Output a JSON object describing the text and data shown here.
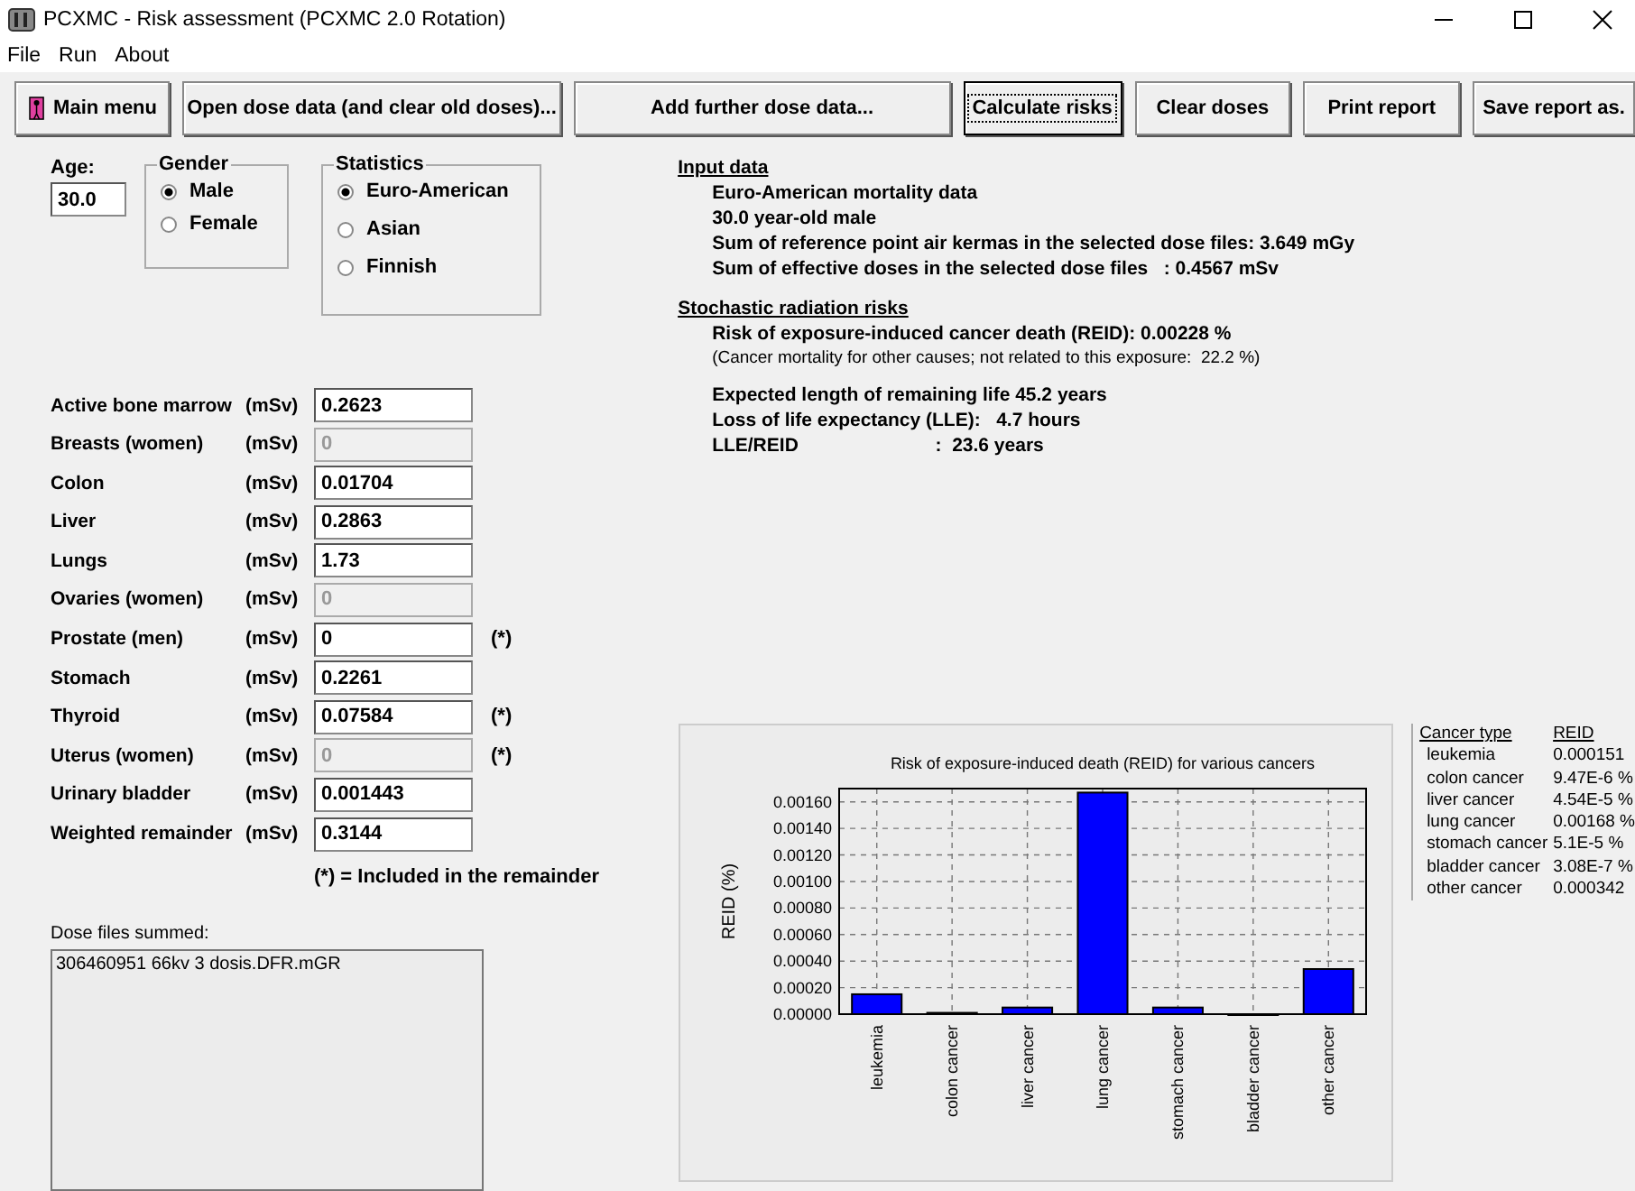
{
  "window": {
    "title": "PCXMC - Risk assessment (PCXMC 2.0 Rotation)"
  },
  "menu": [
    "File",
    "Run",
    "About"
  ],
  "toolbar": [
    {
      "label": "Main menu",
      "kind": "icon",
      "focused": false
    },
    {
      "label": "Open dose data (and clear old doses)...",
      "kind": "text",
      "focused": false
    },
    {
      "label": "Add further dose data...",
      "kind": "text",
      "focused": false
    },
    {
      "label": "Calculate risks",
      "kind": "text",
      "focused": true
    },
    {
      "label": "Clear doses",
      "kind": "text",
      "focused": false
    },
    {
      "label": "Print report",
      "kind": "text",
      "focused": false
    },
    {
      "label": "Save report as.",
      "kind": "text",
      "focused": false
    }
  ],
  "age": {
    "label": "Age:",
    "value": "30.0"
  },
  "gender": {
    "title": "Gender",
    "options": [
      {
        "label": "Male",
        "selected": true
      },
      {
        "label": "Female",
        "selected": false
      }
    ]
  },
  "statistics": {
    "title": "Statistics",
    "options": [
      {
        "label": "Euro-American",
        "selected": true
      },
      {
        "label": "Asian",
        "selected": false
      },
      {
        "label": "Finnish",
        "selected": false
      }
    ]
  },
  "organs": [
    {
      "label": "Active bone marrow",
      "unit": "(mSv)",
      "value": "0.2623",
      "disabled": false
    },
    {
      "label": "Breasts  (women)",
      "unit": "(mSv)",
      "value": "0",
      "disabled": true
    },
    {
      "label": "Colon",
      "unit": "(mSv)",
      "value": "0.01704",
      "disabled": false
    },
    {
      "label": "Liver",
      "unit": "(mSv)",
      "value": "0.2863",
      "disabled": false
    },
    {
      "label": "Lungs",
      "unit": "(mSv)",
      "value": "1.73",
      "disabled": false
    },
    {
      "label": "Ovaries (women)",
      "unit": "(mSv)",
      "value": "0",
      "disabled": true
    },
    {
      "label": "Prostate (men)",
      "unit": "(mSv)",
      "value": "0",
      "disabled": false,
      "note": "(*)"
    },
    {
      "label": "Stomach",
      "unit": "(mSv)",
      "value": "0.2261",
      "disabled": false
    },
    {
      "label": "Thyroid",
      "unit": "(mSv)",
      "value": "0.07584",
      "disabled": false,
      "note": "(*)"
    },
    {
      "label": "Uterus (women)",
      "unit": "(mSv)",
      "value": "0",
      "disabled": true,
      "note": "(*)"
    },
    {
      "label": "Urinary bladder",
      "unit": "(mSv)",
      "value": "0.001443",
      "disabled": false
    },
    {
      "label": "Weighted remainder",
      "unit": "(mSv)",
      "value": "0.3144",
      "disabled": false
    }
  ],
  "remainder_note": "(*) = Included in the remainder",
  "dose_files": {
    "label": "Dose files summed:",
    "items": [
      "306460951 66kv 3 dosis.DFR.mGR"
    ]
  },
  "input_data": {
    "heading": "Input data",
    "lines": [
      "Euro-American mortality data",
      "30.0 year-old male",
      "Sum of reference point air kermas in the selected dose files: 3.649 mGy",
      "Sum of effective doses in the selected dose files   : 0.4567 mSv"
    ]
  },
  "risks": {
    "heading": "Stochastic radiation risks",
    "reid": "Risk of exposure-induced cancer death (REID): 0.00228 %",
    "note": "(Cancer mortality for other causes; not related to this exposure:  22.2 %)",
    "lines": [
      "Expected length of remaining life 45.2 years",
      "Loss of life expectancy (LLE):   4.7 hours",
      "LLE/REID                          :  23.6 years"
    ]
  },
  "chart_data": {
    "type": "bar",
    "title": "Risk of exposure-induced death (REID) for various cancers",
    "ylabel": "REID (%)",
    "categories": [
      "leukemia",
      "colon cancer",
      "liver cancer",
      "lung cancer",
      "stomach cancer",
      "bladder cancer",
      "other cancer"
    ],
    "values": [
      0.00015,
      1e-05,
      5e-05,
      0.00167,
      5e-05,
      0,
      0.00034
    ],
    "grid": true,
    "ylim": [
      0,
      0.0017
    ],
    "yticks": [
      {
        "value": 0,
        "label": "0.00000"
      },
      {
        "value": 0.0002,
        "label": "0.00020"
      },
      {
        "value": 0.0004,
        "label": "0.00040"
      },
      {
        "value": 0.0006,
        "label": "0.00060"
      },
      {
        "value": 0.0008,
        "label": "0.00080"
      },
      {
        "value": 0.001,
        "label": "0.00100"
      },
      {
        "value": 0.0012,
        "label": "0.00120"
      },
      {
        "value": 0.0014,
        "label": "0.00140"
      },
      {
        "value": 0.0016,
        "label": "0.00160"
      }
    ]
  },
  "legend": {
    "columns": [
      "Cancer type",
      "REID"
    ],
    "rows": [
      [
        "leukemia",
        "0.000151"
      ],
      [
        "colon cancer",
        "9.47E-6 %"
      ],
      [
        "liver cancer",
        "4.54E-5 %"
      ],
      [
        "lung cancer",
        "0.00168 %"
      ],
      [
        "stomach cancer",
        "5.1E-5 %"
      ],
      [
        "bladder cancer",
        "3.08E-7 %"
      ],
      [
        "other cancer",
        "0.000342"
      ]
    ]
  }
}
